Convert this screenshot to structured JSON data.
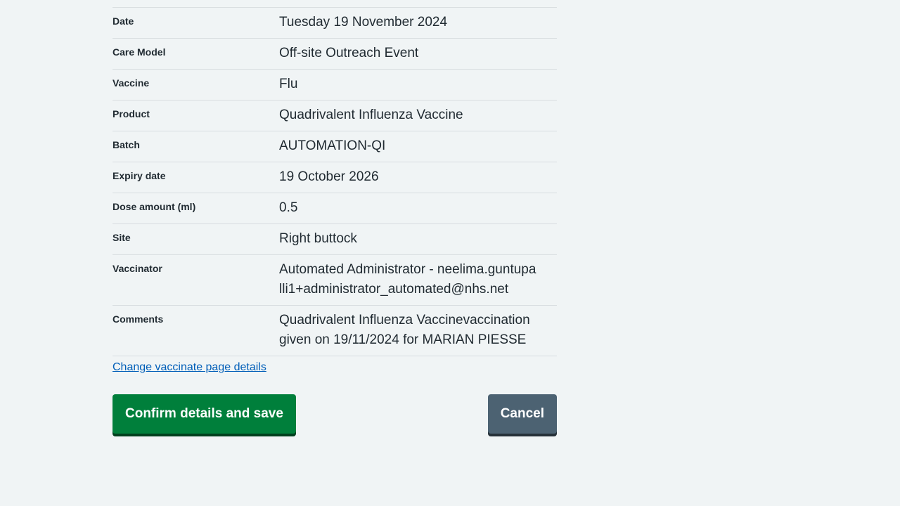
{
  "summary": [
    {
      "label": "Date",
      "value": "Tuesday 19 November 2024"
    },
    {
      "label": "Care Model",
      "value": "Off-site Outreach Event"
    },
    {
      "label": "Vaccine",
      "value": "Flu"
    },
    {
      "label": "Product",
      "value": "Quadrivalent Influenza Vaccine"
    },
    {
      "label": "Batch",
      "value": "AUTOMATION-QI"
    },
    {
      "label": "Expiry date",
      "value": "19 October 2026"
    },
    {
      "label": "Dose amount (ml)",
      "value": "0.5"
    },
    {
      "label": "Site",
      "value": "Right buttock"
    },
    {
      "label": "Vaccinator",
      "value": "Automated Administrator - neelima.guntupalli1+administrator_automated@nhs.net"
    },
    {
      "label": "Comments",
      "value": "Quadrivalent Influenza Vaccinevaccination given on 19/11/2024 for MARIAN PIESSE"
    }
  ],
  "change_link": "Change vaccinate page details",
  "actions": {
    "confirm_label": "Confirm details and save",
    "cancel_label": "Cancel"
  }
}
